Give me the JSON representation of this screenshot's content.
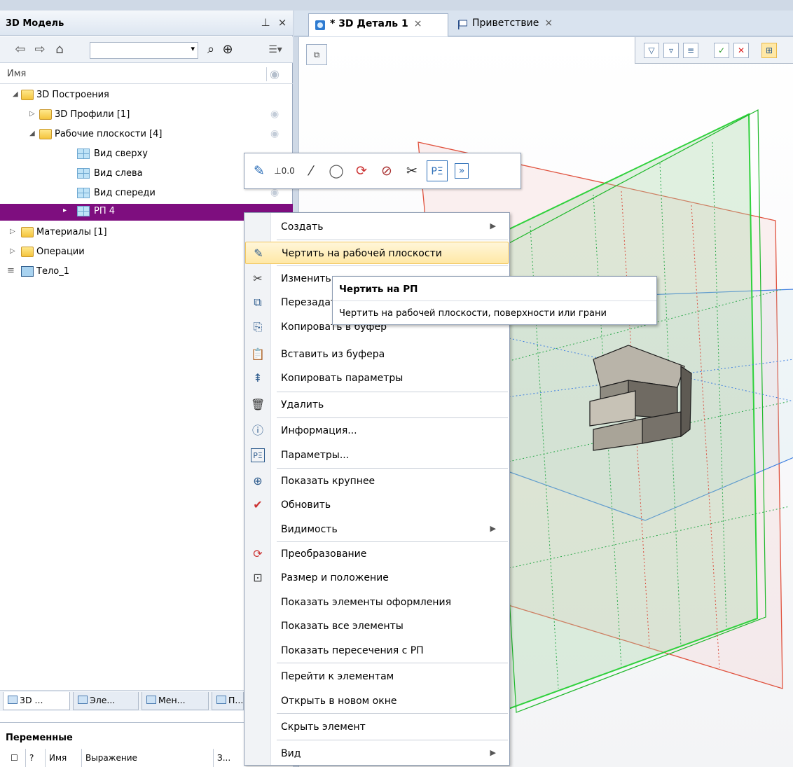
{
  "left_panel": {
    "title": "3D Модель",
    "pin_icon": "pin-icon",
    "close_glyph": "×",
    "search_placeholder": "",
    "column_name": "Имя",
    "tree": [
      {
        "label": "3D Построения",
        "icon": "folder-icon",
        "expanded": true
      },
      {
        "label": "3D Профили [1]",
        "icon": "folder-icon",
        "expanded": false
      },
      {
        "label": "Рабочие плоскости [4]",
        "icon": "folder-icon",
        "expanded": true
      },
      {
        "label": "Вид сверху",
        "icon": "plane-icon"
      },
      {
        "label": "Вид слева",
        "icon": "plane-icon"
      },
      {
        "label": "Вид спереди",
        "icon": "plane-icon"
      },
      {
        "label": "РП 4",
        "icon": "plane-icon",
        "selected": true
      },
      {
        "label": "Материалы [1]",
        "icon": "folder-icon",
        "expanded": false
      },
      {
        "label": "Операции",
        "icon": "folder-icon",
        "expanded": false
      },
      {
        "label": "Тело_1",
        "icon": "body-icon"
      }
    ],
    "bottom_tabs": [
      "3D ...",
      "Эле...",
      "Мен...",
      "П..."
    ],
    "variables": {
      "title": "Переменные",
      "columns": [
        "?",
        "Имя",
        "Выражение",
        "З..."
      ]
    }
  },
  "document_tabs": [
    {
      "label": "* 3D Деталь 1",
      "active": true
    },
    {
      "label": "Приветствие",
      "active": false
    }
  ],
  "context_menu": {
    "items": [
      {
        "label": "Создать",
        "icon": "",
        "submenu": true
      },
      {
        "label": "Чертить на рабочей плоскости",
        "icon": "sketch-pencil-icon",
        "highlighted": true
      },
      {
        "label": "Изменить",
        "icon": "scissors-icon"
      },
      {
        "label": "Перезадать",
        "icon": "redefine-icon"
      },
      {
        "label": "Копировать в буфер",
        "icon": "copy-icon"
      },
      {
        "label": "Вставить из буфера",
        "icon": "paste-icon"
      },
      {
        "label": "Копировать параметры",
        "icon": "copy-params-icon"
      },
      {
        "label": "Удалить",
        "icon": "trash-icon"
      },
      {
        "label": "Информация...",
        "icon": "info-icon"
      },
      {
        "label": "Параметры...",
        "icon": "parameters-icon"
      },
      {
        "label": "Показать крупнее",
        "icon": "zoom-in-icon"
      },
      {
        "label": "Обновить",
        "icon": "refresh-icon"
      },
      {
        "label": "Видимость",
        "icon": "",
        "submenu": true
      },
      {
        "label": "Преобразование",
        "icon": "transform-icon"
      },
      {
        "label": "Размер и положение",
        "icon": "size-position-icon"
      },
      {
        "label": "Показать элементы оформления",
        "icon": ""
      },
      {
        "label": "Показать все элементы",
        "icon": ""
      },
      {
        "label": "Показать пересечения с РП",
        "icon": ""
      },
      {
        "label": "Перейти к элементам",
        "icon": ""
      },
      {
        "label": "Открыть в новом окне",
        "icon": ""
      },
      {
        "label": "Скрыть элемент",
        "icon": ""
      },
      {
        "label": "Вид",
        "icon": "",
        "submenu": true
      }
    ]
  },
  "tooltip": {
    "title": "Чертить на РП",
    "description": "Чертить на рабочей плоскости, поверхности или грани"
  },
  "mini_toolbar": {
    "buttons": [
      "sketch-pencil-icon",
      "dimension-icon",
      "line-icon",
      "circle-icon",
      "transform-icon",
      "hide-icon",
      "scissors-icon",
      "parameters-icon",
      "more-icon"
    ],
    "more_glyph": "»"
  }
}
